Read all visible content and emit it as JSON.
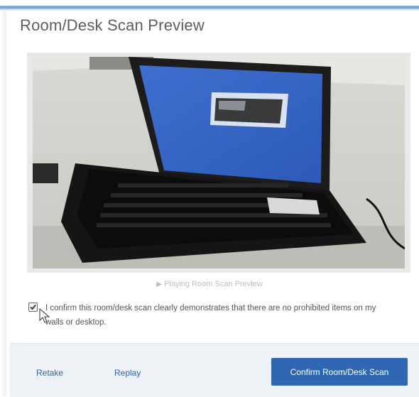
{
  "dialog": {
    "title": "Room/Desk Scan Preview"
  },
  "preview": {
    "status_icon": "play-icon",
    "status_text": "Playing Room Scan Preview"
  },
  "confirmation": {
    "checked": true,
    "text": "I confirm this room/desk scan clearly demonstrates that there are no prohibited items on my walls or desktop."
  },
  "footer": {
    "retake_label": "Retake",
    "replay_label": "Replay",
    "confirm_label": "Confirm Room/Desk Scan"
  },
  "colors": {
    "accent": "#2f67b3",
    "link": "#2f66b3",
    "footer_bg": "#eef1f5"
  }
}
